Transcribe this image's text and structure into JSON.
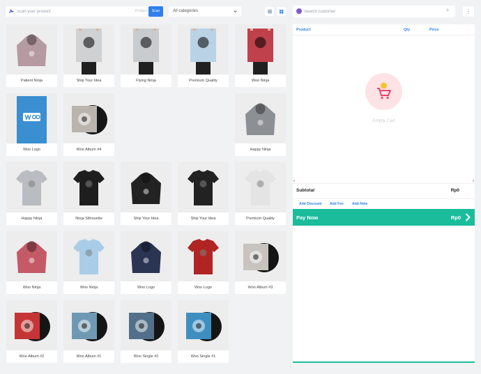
{
  "search": {
    "placeholder": "Scan your product",
    "tag": "Product",
    "button": "Scan"
  },
  "categories": {
    "selected": "All categories"
  },
  "products": [
    {
      "name": "Patient Ninja",
      "art": "hoodie",
      "color": "#b59aa1"
    },
    {
      "name": "Ship Your Idea",
      "art": "poster",
      "color": "#cfd1d3"
    },
    {
      "name": "Flying Ninja",
      "art": "poster",
      "color": "#c9ccce"
    },
    {
      "name": "Premium Quality",
      "art": "poster",
      "color": "#b9d2e6"
    },
    {
      "name": "Woo Ninja",
      "art": "poster",
      "color": "#c0404c"
    },
    {
      "name": "Woo Logo",
      "art": "poster-woo",
      "color": "#3a8fd1"
    },
    {
      "name": "Woo Album #4",
      "art": "album",
      "color": "#b9b4ad"
    },
    {
      "name": "Happy Ninja",
      "art": "hoodie",
      "color": "#8c8f94"
    },
    {
      "name": "Happy Ninja",
      "art": "tshirt",
      "color": "#b9bcc0"
    },
    {
      "name": "Ninja Silhouette",
      "art": "tshirt",
      "color": "#1e1e1e"
    },
    {
      "name": "Ship Your Idea",
      "art": "hoodie",
      "color": "#222222"
    },
    {
      "name": "Ship Your Idea",
      "art": "tshirt",
      "color": "#222222"
    },
    {
      "name": "Premium Quality",
      "art": "tshirt",
      "color": "#e4e4e4"
    },
    {
      "name": "Woo Ninja",
      "art": "hoodie",
      "color": "#c45a66"
    },
    {
      "name": "Woo Ninja",
      "art": "tshirt",
      "color": "#a9cde8"
    },
    {
      "name": "Woo Logo",
      "art": "hoodie",
      "color": "#2a3554"
    },
    {
      "name": "Woo Logo",
      "art": "tshirt",
      "color": "#b02424"
    },
    {
      "name": "Woo Album #3",
      "art": "album",
      "color": "#c7c4c0"
    },
    {
      "name": "Woo Album #2",
      "art": "album",
      "color": "#c53535"
    },
    {
      "name": "Woo Album #1",
      "art": "album",
      "color": "#6f99b3"
    },
    {
      "name": "Woo Single #2",
      "art": "album",
      "color": "#53708a"
    },
    {
      "name": "Woo Single #1",
      "art": "album",
      "color": "#3e8fc0"
    }
  ],
  "customer": {
    "placeholder": "Search customer"
  },
  "cart": {
    "col_product": "Product",
    "col_qty": "Qty",
    "col_price": "Price",
    "empty_text": "Empty Cart",
    "subtotal_label": "Subtotal",
    "subtotal_value": "Rp0",
    "add_discount": "Add Discount",
    "add_fee": "Add Fee",
    "add_note": "Add Note",
    "pay_label": "Pay Now",
    "pay_value": "Rp0"
  },
  "colors": {
    "accent": "#2f80ed",
    "pay": "#1abc9c",
    "empty_circle": "#fde3e6"
  }
}
